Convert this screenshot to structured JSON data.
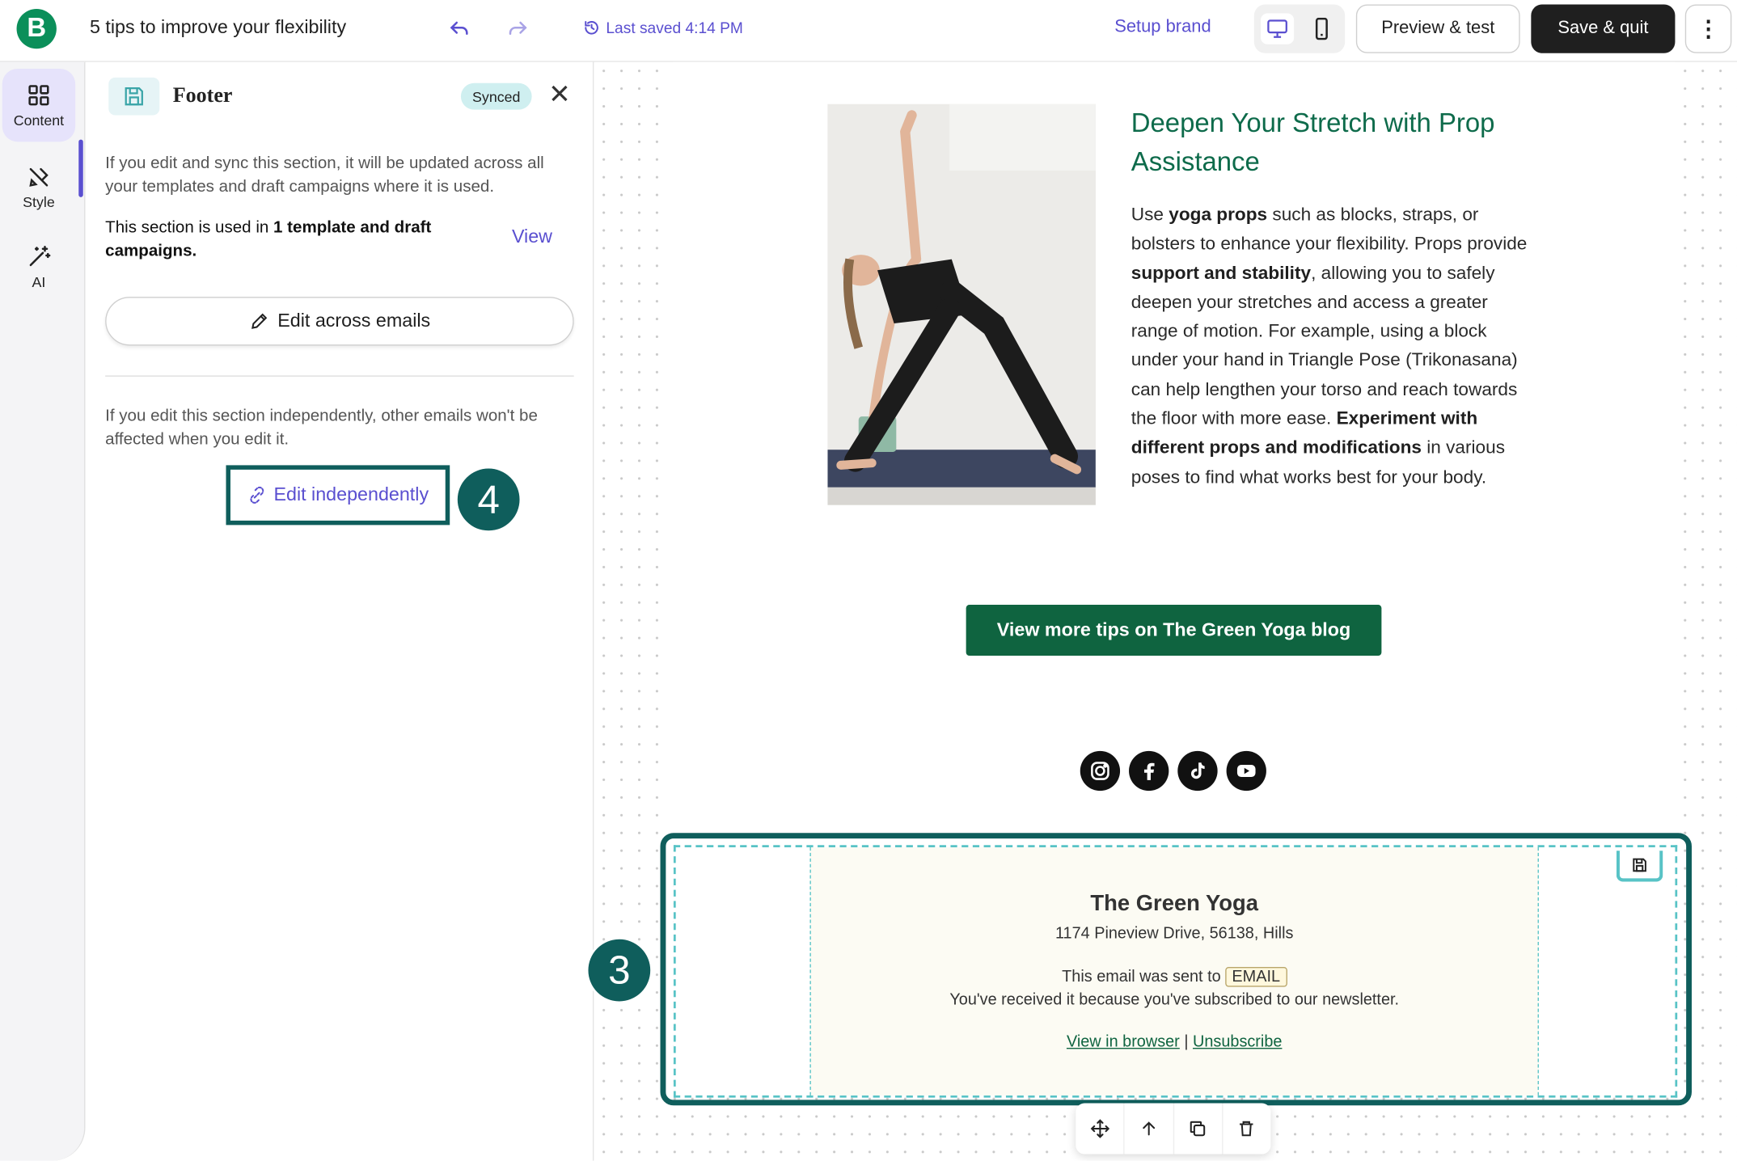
{
  "header": {
    "logo_letter": "B",
    "title": "5 tips to improve your flexibility",
    "last_saved": "Last saved 4:14 PM",
    "setup_brand": "Setup brand",
    "preview": "Preview & test",
    "save_quit": "Save & quit",
    "more": "⋮"
  },
  "rail": {
    "items": [
      {
        "label": "Content",
        "icon": "grid-icon"
      },
      {
        "label": "Style",
        "icon": "brush-icon"
      },
      {
        "label": "AI",
        "icon": "magic-wand-icon"
      }
    ]
  },
  "panel": {
    "title": "Footer",
    "status": "Synced",
    "sync_note": "If you edit and sync this section, it will be updated across all your templates and draft campaigns where it is used.",
    "used_prefix": "This section is used in ",
    "used_bold": "1 template and draft campaigns.",
    "view_link": "View",
    "edit_across": "Edit across emails",
    "independent_note": "If you edit this section independently, other emails won't be affected when you edit it.",
    "edit_independently": "Edit independently"
  },
  "annotations": {
    "step4": "4",
    "step3": "3"
  },
  "email": {
    "heading": "Deepen Your Stretch with Prop Assistance",
    "body_parts": {
      "p1": "Use ",
      "b1": "yoga props",
      "p2": " such as blocks, straps, or bolsters to enhance your flexibility. Props provide ",
      "b2": "support and stability",
      "p3": ", allowing you to safely deepen your stretches and access a greater range of motion. For example, using a block under your hand in Triangle Pose (Trikonasana) can help lengthen your torso and reach towards the floor with more ease. ",
      "b3": "Experiment with different props and modifications",
      "p4": " in various poses to find what works best for your body."
    },
    "cta": "View more tips on The Green Yoga blog",
    "social_icons": [
      "instagram-icon",
      "facebook-icon",
      "tiktok-icon",
      "youtube-icon"
    ]
  },
  "footer": {
    "name": "The Green Yoga",
    "address": "1174 Pineview Drive, 56138, Hills",
    "sent_prefix": "This email was sent to ",
    "email_tag": "EMAIL",
    "received": "You've received it because you've subscribed to our newsletter.",
    "view_browser": "View in browser",
    "separator": " | ",
    "unsubscribe": "Unsubscribe"
  },
  "colors": {
    "accent": "#5a4fd0",
    "brand_green": "#0f6440",
    "annotation": "#0f5e5c",
    "dashed": "#58c3c6"
  }
}
